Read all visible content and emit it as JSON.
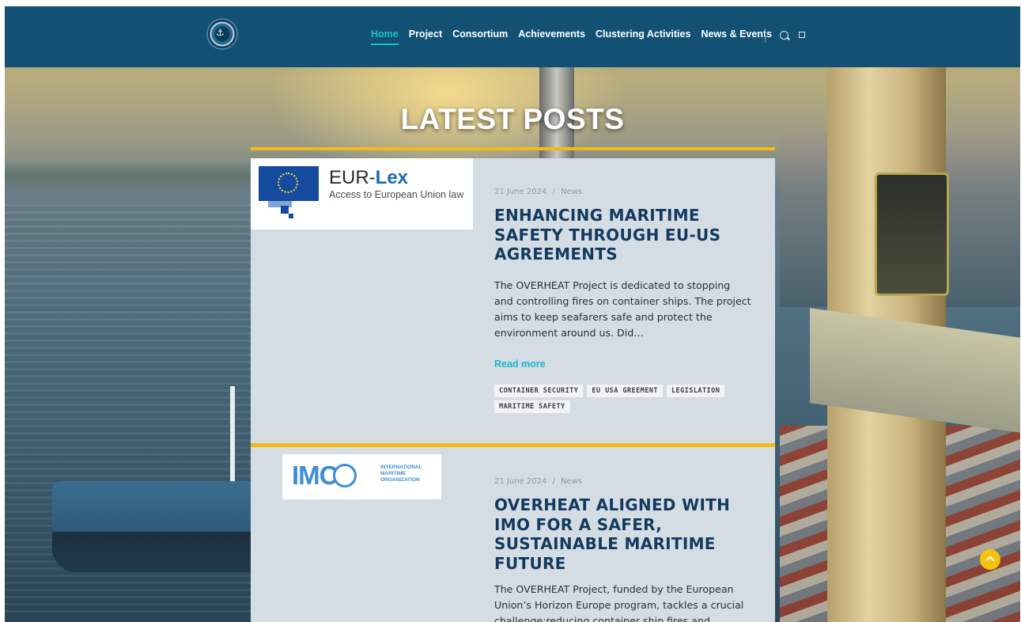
{
  "header": {
    "nav": [
      {
        "label": "Home",
        "active": true
      },
      {
        "label": "Project"
      },
      {
        "label": "Consortium"
      },
      {
        "label": "Achievements"
      },
      {
        "label": "Clustering Activities"
      },
      {
        "label": "News & Events"
      }
    ],
    "icons": [
      "search-icon",
      "square-icon"
    ]
  },
  "hero": {
    "title": "LATEST POSTS"
  },
  "posts": [
    {
      "thumbnail": {
        "brand_light": "EUR-",
        "brand_bold": "Lex",
        "subtitle": "Access to European Union law"
      },
      "date": "21 June 2024",
      "separator": "/",
      "category": "News",
      "title": "ENHANCING MARITIME SAFETY THROUGH EU-US AGREEMENTS",
      "excerpt": "The OVERHEAT Project is dedicated to stopping and controlling fires on container ships. The project aims to keep seafarers safe and protect the environment around us. Did…",
      "read_more": "Read more",
      "tags": [
        "CONTAINER SECURITY",
        "EU USA GREEMENT",
        "LEGISLATION",
        "MARITIME SAFETY"
      ]
    },
    {
      "thumbnail": {
        "letters": "IMO",
        "org_line1": "INTERNATIONAL",
        "org_line2": "MARITIME",
        "org_line3": "ORGANIZATION"
      },
      "date": "21 June 2024",
      "separator": "/",
      "category": "News",
      "title": "OVERHEAT ALIGNED WITH IMO FOR A SAFER, SUSTAINABLE MARITIME FUTURE",
      "excerpt": "The OVERHEAT Project, funded by the European Union’s Horizon Europe program, tackles a crucial challenge:reducing container ship fires and enhancing"
    }
  ],
  "colors": {
    "header": "#125173",
    "accent": "#1bbfd0",
    "rule": "#f2bd12",
    "card": "#d4dde4",
    "title": "#133a5e"
  }
}
